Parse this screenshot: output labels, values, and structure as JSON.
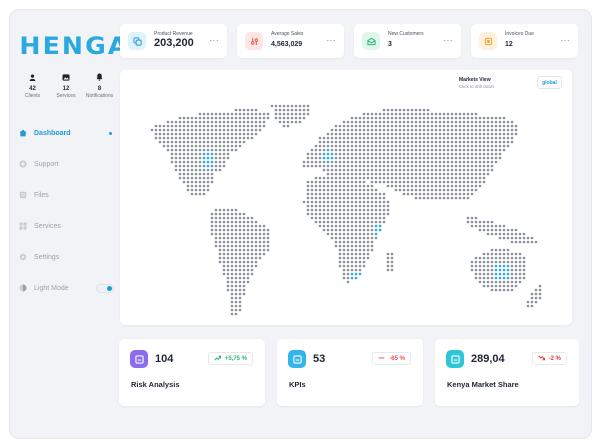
{
  "brand": {
    "logo_text": "HENGA",
    "accent": "#1e9bd7"
  },
  "sidebar": {
    "stats": [
      {
        "icon": "user-icon",
        "value": "42",
        "label": "Clients"
      },
      {
        "icon": "services-icon",
        "value": "12",
        "label": "Services"
      },
      {
        "icon": "bell-icon",
        "value": "8",
        "label": "Notifications"
      }
    ],
    "menu": [
      {
        "icon": "dashboard-icon",
        "label": "Dashboard",
        "active": true
      },
      {
        "icon": "support-icon",
        "label": "Support"
      },
      {
        "icon": "files-icon",
        "label": "Files"
      },
      {
        "icon": "grid-icon",
        "label": "Services"
      },
      {
        "icon": "gear-icon",
        "label": "Settings"
      },
      {
        "icon": "contrast-icon",
        "label": "Light Mode",
        "toggle_on": true
      }
    ]
  },
  "top_cards": [
    {
      "label": "Product Revenue",
      "value": "203,200",
      "more": "···",
      "icon": "layers-icon",
      "color": "#1e9bd7",
      "bg": "#dff1fb"
    },
    {
      "label": "Average Sales",
      "value": "4,563,029",
      "more": "···",
      "icon": "sliders-icon",
      "color": "#e8574f",
      "bg": "#fde6e4"
    },
    {
      "label": "New Customers",
      "value": "3",
      "more": "···",
      "icon": "envelope-icon",
      "color": "#2bb673",
      "bg": "#dff6ea"
    },
    {
      "label": "Invoices Due",
      "value": "12",
      "more": "···",
      "icon": "invoice-icon",
      "color": "#f0a030",
      "bg": "#fdf0dc"
    }
  ],
  "map": {
    "title": "Markets View",
    "subtitle": "Click to drill down",
    "scope_button": "global",
    "dot_color": "#8a8f99",
    "highlight_color": "#2aa8e0"
  },
  "bottom_cards": [
    {
      "value": "104",
      "label": "Risk Analysis",
      "change": "+5,75 %",
      "trend": "up",
      "change_color": "#2bb673",
      "icon": "chart-box-icon",
      "icon_bg": "#8b6cf0"
    },
    {
      "value": "53",
      "label": "KPIs",
      "change": "-65 %",
      "trend": "flat",
      "change_color": "#e8574f",
      "icon": "chart-box-icon",
      "icon_bg": "#35b4ea"
    },
    {
      "value": "289,04",
      "label": "Kenya Market Share",
      "change": "-2 %",
      "trend": "down",
      "change_color": "#e03a3a",
      "icon": "chart-box-icon",
      "icon_bg": "#2fc6d6"
    }
  ]
}
